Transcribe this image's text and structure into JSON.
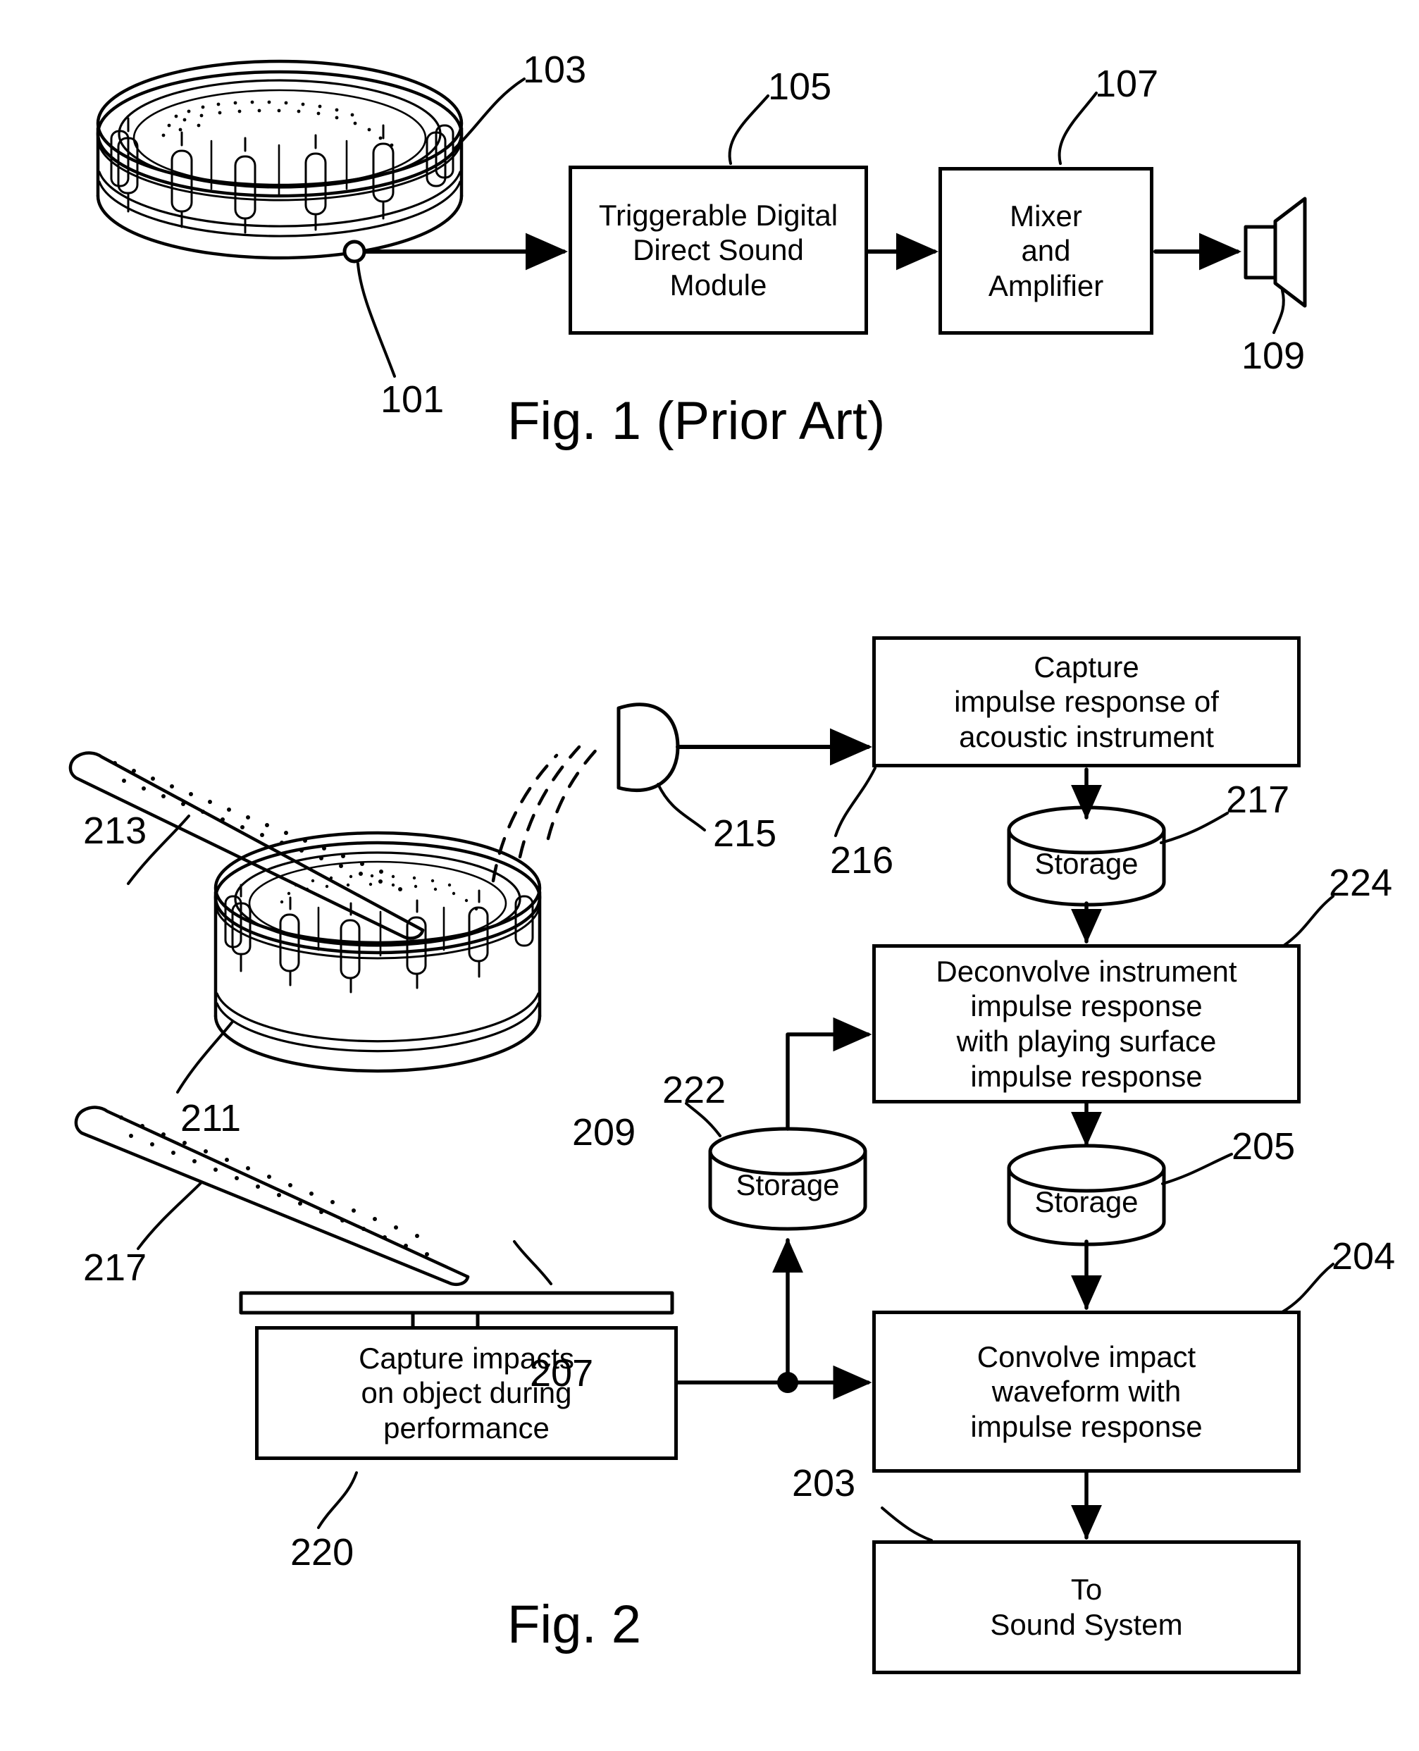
{
  "document": {
    "type": "patent-drawing-sheet",
    "figures": [
      "Fig. 1 (Prior Art)",
      "Fig. 2"
    ]
  },
  "fig1": {
    "caption": "Fig. 1 (Prior Art)",
    "boxes": {
      "module": "Triggerable Digital\nDirect Sound\nModule",
      "mixer": "Mixer\nand\nAmplifier"
    },
    "reference_numerals": {
      "trigger_sensor": "101",
      "acoustic_drum": "103",
      "sound_module": "105",
      "mixer_amplifier": "107",
      "loudspeaker": "109"
    },
    "parts": {
      "drum": "acoustic snare drum",
      "sensor_dot": "trigger pickup",
      "speaker": "loudspeaker"
    }
  },
  "fig2": {
    "caption": "Fig. 2",
    "boxes": {
      "capture_ir": "Capture\nimpulse response of\nacoustic instrument",
      "deconvolve": "Deconvolve instrument\nimpulse response\nwith playing surface\nimpulse response",
      "capture_impacts": "Capture impacts\non object during\nperformance",
      "convolve": "Convolve impact\nwaveform with\nimpulse response",
      "to_sound_system": "To\nSound System"
    },
    "cylinders": {
      "storage_217": "Storage",
      "storage_222": "Storage",
      "storage_205": "Storage"
    },
    "reference_numerals": {
      "to_sound_system": "203",
      "convolve": "204",
      "storage_ir_result": "205",
      "sensor_under_pad": "207",
      "playing_surface_pad": "209",
      "acoustic_drum": "211",
      "drum_stick_upper": "213",
      "microphone": "215",
      "capture_ir": "216",
      "storage_capture": "217",
      "drum_stick_lower": "217",
      "capture_impacts": "220",
      "storage_impacts": "222",
      "deconvolve": "224"
    },
    "parts": {
      "drum": "acoustic snare drum",
      "microphone": "microphone",
      "stick_upper": "drum stick striking drum",
      "stick_lower": "drum stick striking practice pad",
      "pad": "playing surface / practice pad",
      "pickup": "impact sensor",
      "junction": "signal junction dot"
    }
  },
  "colors": {
    "ink": "#000000",
    "paper": "#ffffff"
  }
}
